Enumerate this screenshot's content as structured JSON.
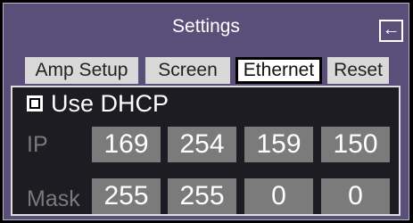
{
  "header": {
    "title": "Settings",
    "back_glyph": "←"
  },
  "tabs": [
    {
      "label": "Amp Setup",
      "active": false
    },
    {
      "label": "Screen",
      "active": false
    },
    {
      "label": "Ethernet",
      "active": true
    },
    {
      "label": "Reset",
      "active": false
    }
  ],
  "dhcp": {
    "label": "Use DHCP",
    "checked": true
  },
  "ip": {
    "label": "IP",
    "octets": [
      "169",
      "254",
      "159",
      "150"
    ]
  },
  "mask": {
    "label": "Mask",
    "octets": [
      "255",
      "255",
      "0",
      "0"
    ]
  }
}
